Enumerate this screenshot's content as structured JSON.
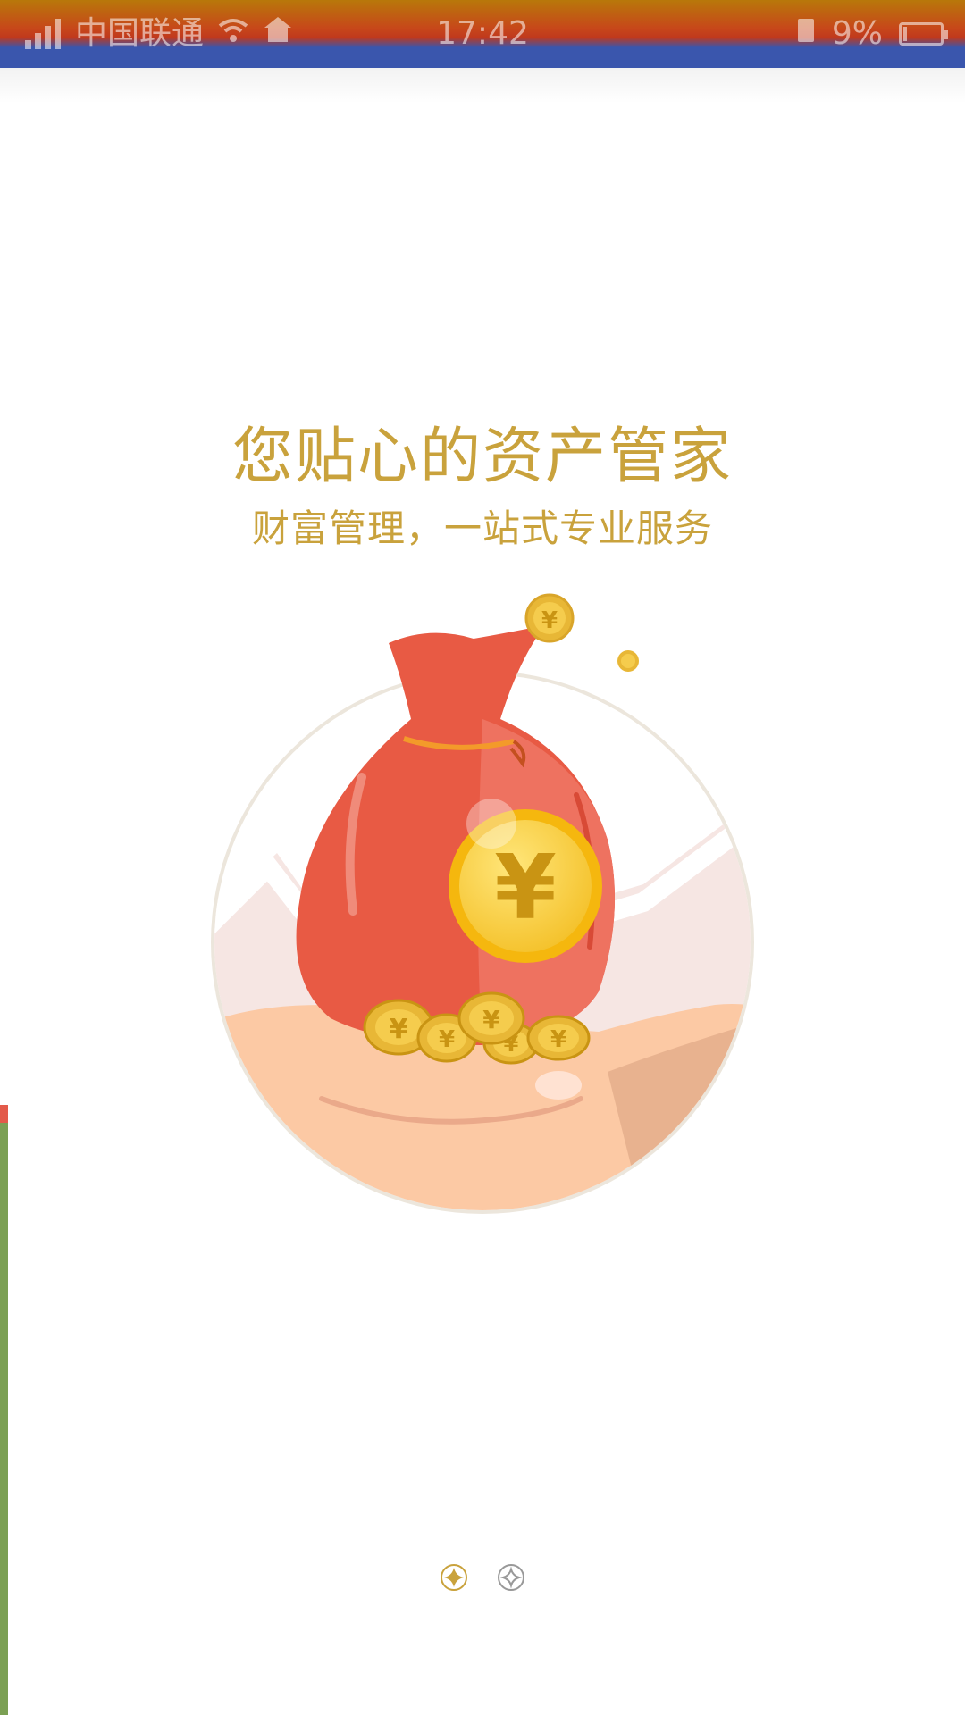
{
  "status_bar": {
    "carrier": "中国联通",
    "time": "17:42",
    "battery_percent": "9%",
    "battery_level": 0.09
  },
  "onboarding": {
    "headline": "您贴心的资产管家",
    "subheadline": "财富管理，一站式专业服务",
    "illustration": "money-bag-on-hand",
    "coin_symbol": "¥"
  },
  "pager": {
    "total": 2,
    "active_index": 0
  },
  "colors": {
    "accent_gold": "#c9a23c",
    "bag_red": "#e85a44",
    "coin_gold": "#f6c42b",
    "hand_skin": "#fcc9a4"
  }
}
